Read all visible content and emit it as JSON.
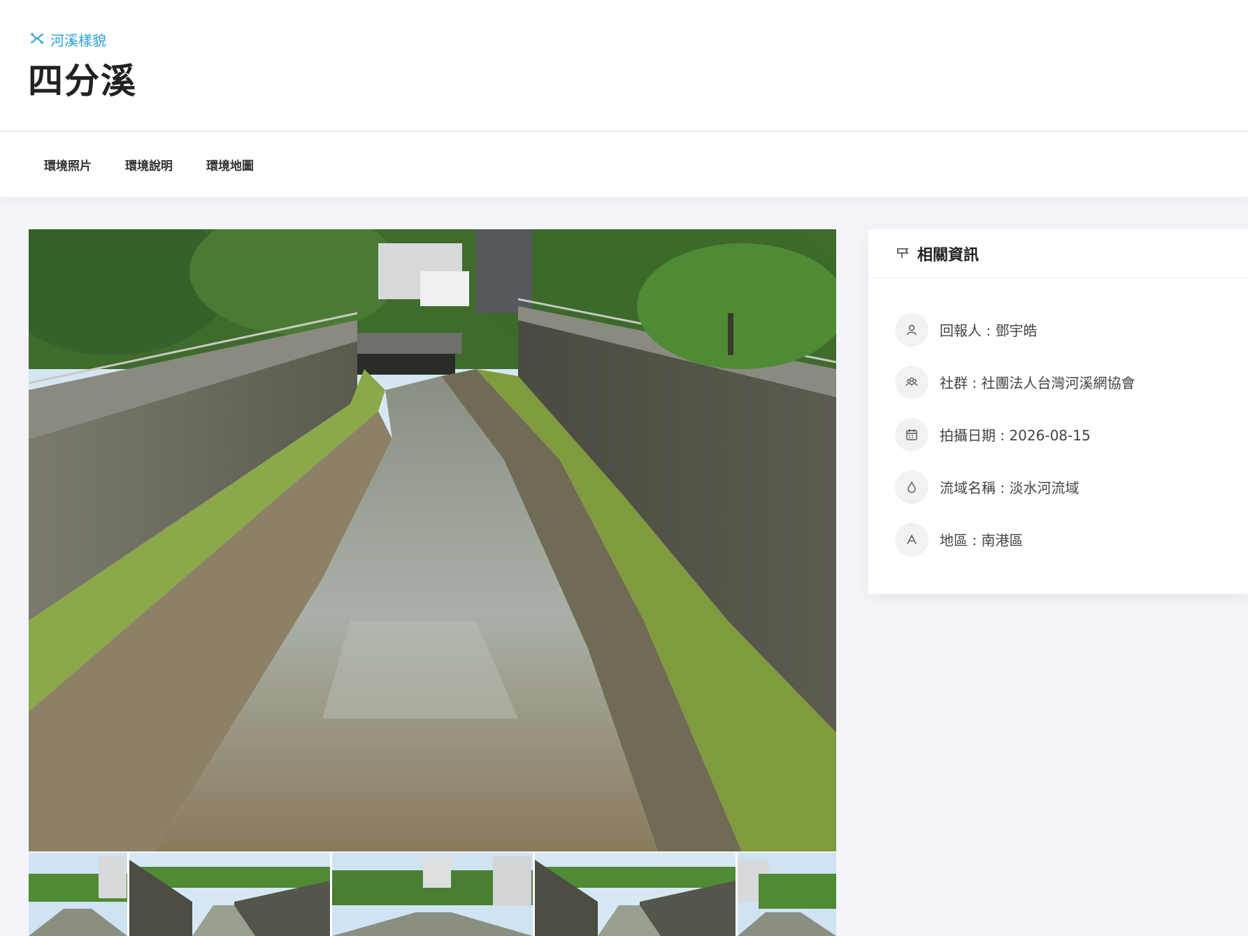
{
  "header": {
    "breadcrumb_label": "河溪樣貌",
    "title": "四分溪"
  },
  "tabs": [
    {
      "label": "環境照片"
    },
    {
      "label": "環境說明"
    },
    {
      "label": "環境地圖"
    }
  ],
  "info_card": {
    "title": "相關資訊",
    "items": [
      {
        "icon": "user-icon",
        "text": "回報人 : 鄧宇皓"
      },
      {
        "icon": "group-icon",
        "text": "社群 : 社團法人台灣河溪網協會"
      },
      {
        "icon": "calendar-icon",
        "text": "拍攝日期 : 2026-08-15"
      },
      {
        "icon": "water-drop-icon",
        "text": "流域名稱 : 淡水河流域"
      },
      {
        "icon": "mountain-icon",
        "text": "地區 : 南港區"
      }
    ]
  },
  "colors": {
    "accent": "#2aa0d8",
    "page_bg": "#f4f5f8",
    "card_bg": "#ffffff"
  }
}
